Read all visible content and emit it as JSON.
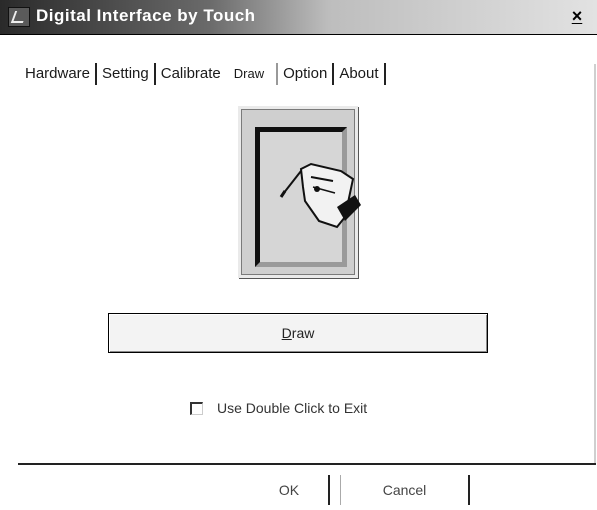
{
  "window": {
    "title": "Digital Interface by Touch",
    "close_label": "×"
  },
  "tabs": [
    {
      "label": "Hardware"
    },
    {
      "label": "Setting"
    },
    {
      "label": "Calibrate"
    },
    {
      "label": "Draw",
      "active": true
    },
    {
      "label": "Option"
    },
    {
      "label": "About"
    }
  ],
  "draw_panel": {
    "illustration_icon": "hand-with-stylus-icon",
    "draw_button": {
      "underlined": "D",
      "rest": "raw"
    },
    "checkbox": {
      "label": "Use Double Click to Exit",
      "checked": false
    }
  },
  "footer": {
    "ok_label": "OK",
    "cancel_label": "Cancel"
  },
  "colors": {
    "title_bar_dark": "#2a2a2a",
    "title_bar_light": "#e2e2e2",
    "illustration_bg": "#cfcfcf"
  }
}
